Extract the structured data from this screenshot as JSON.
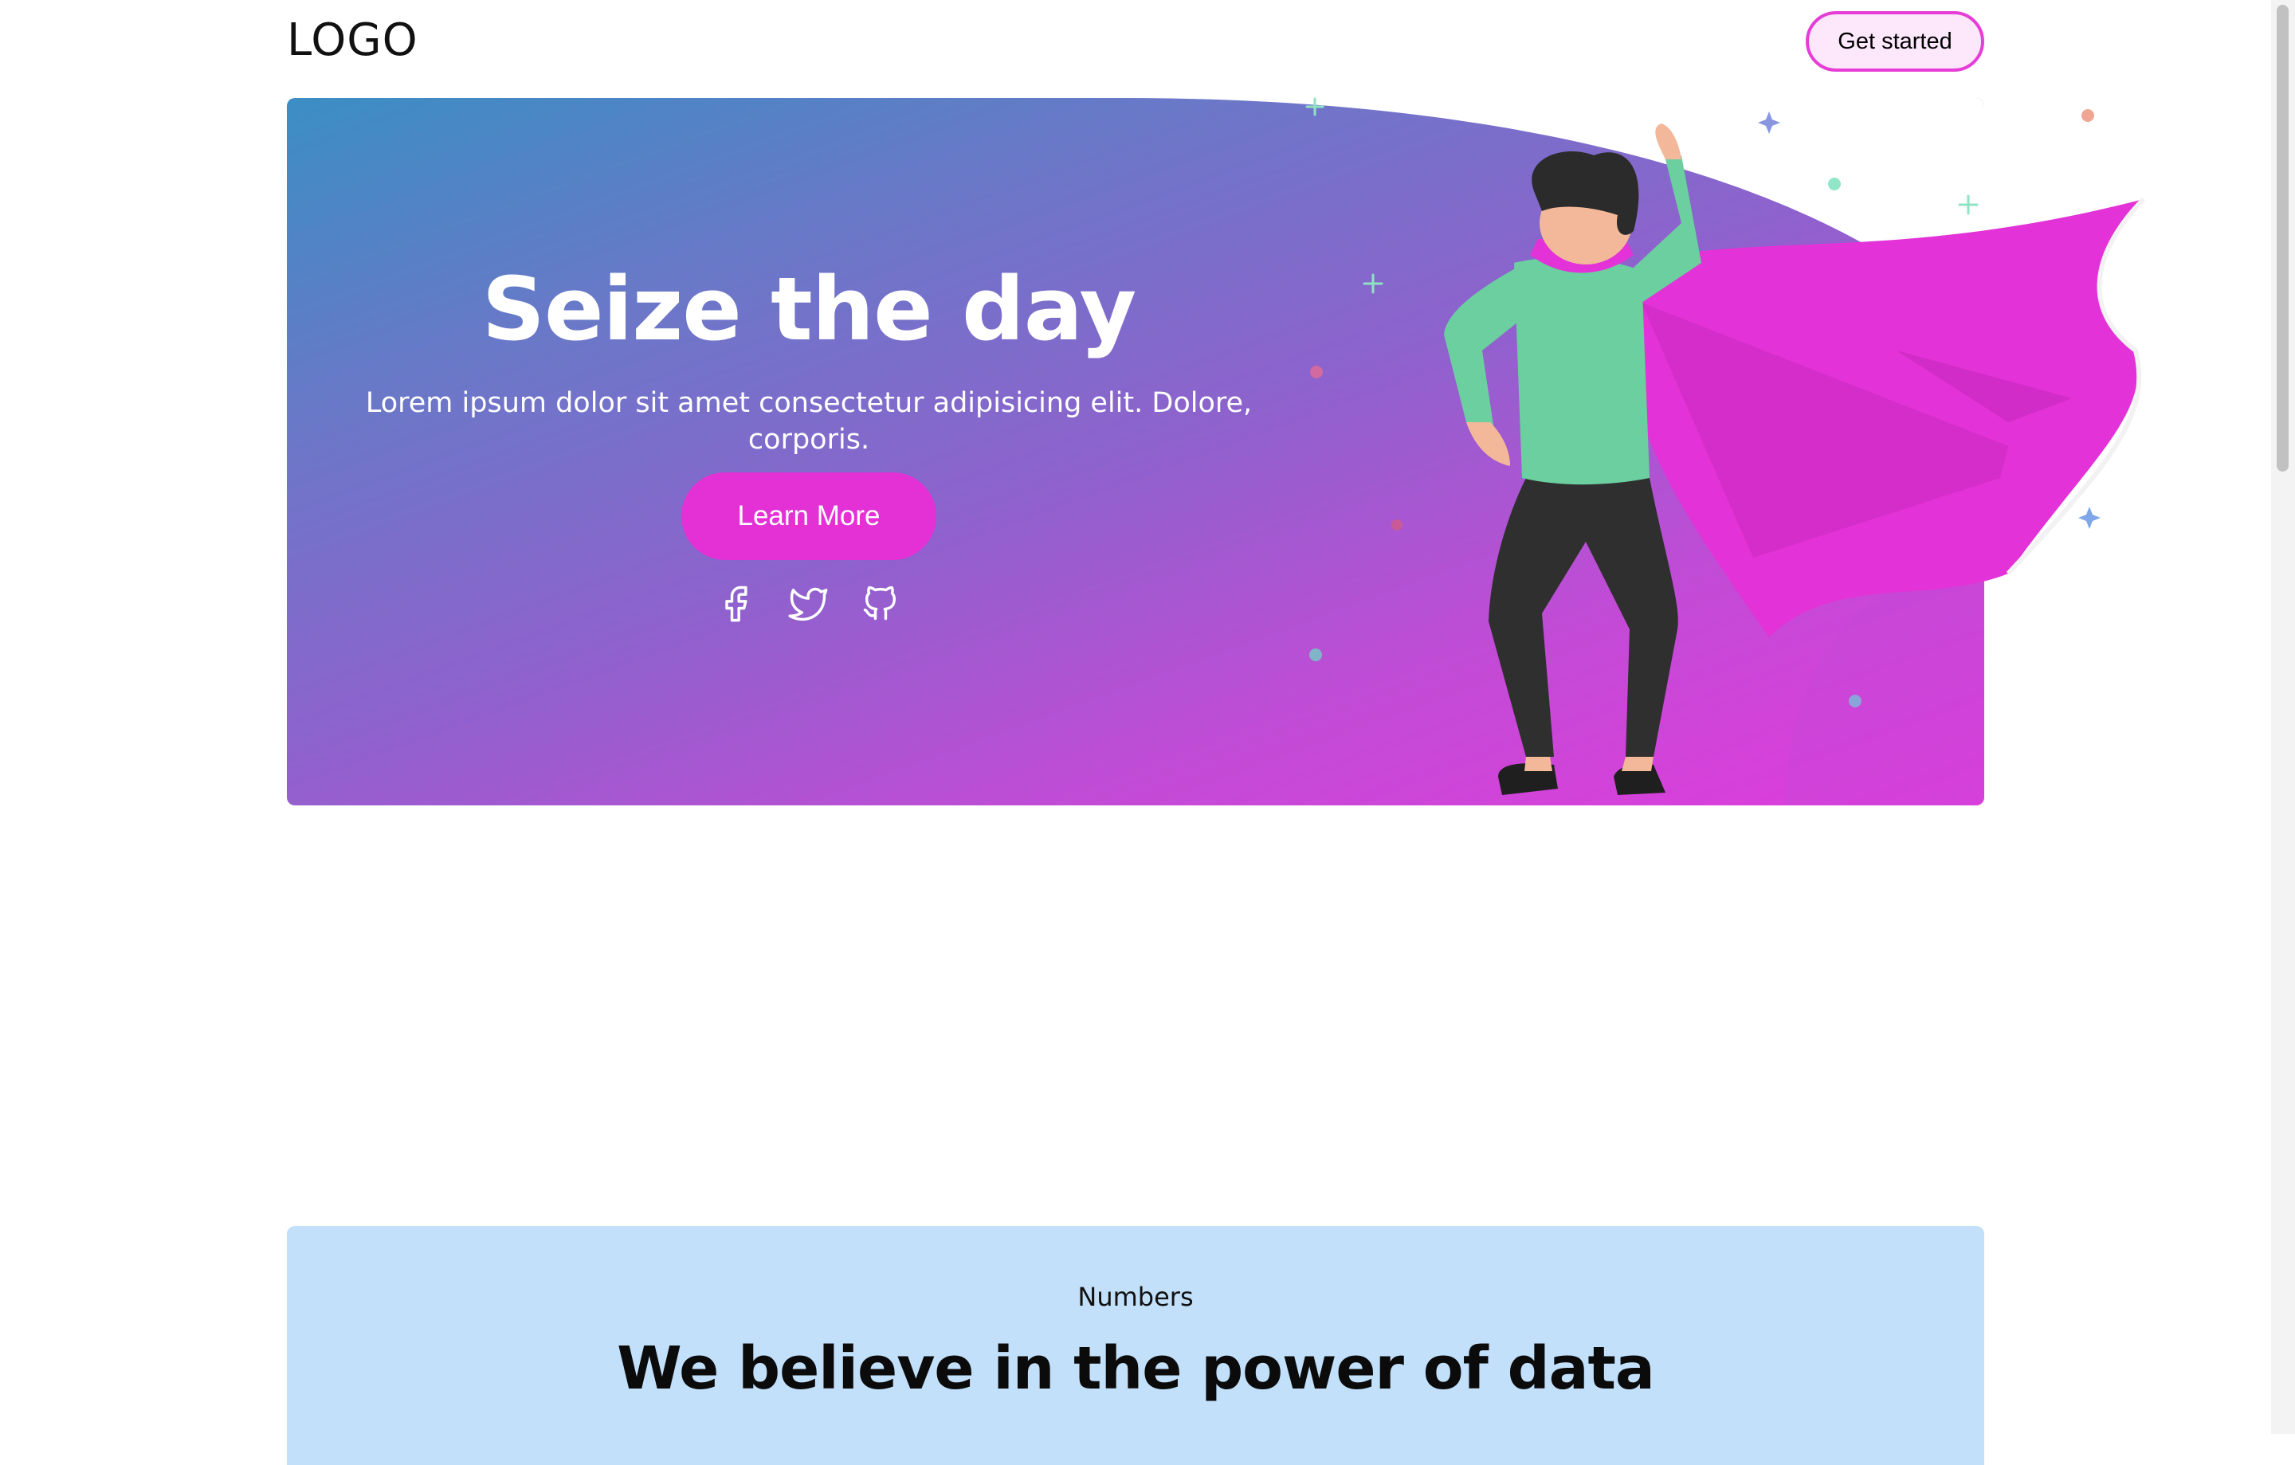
{
  "header": {
    "logo": "LOGO",
    "cta_label": "Get started"
  },
  "hero": {
    "title": "Seize the day",
    "subtitle": "Lorem ipsum dolor sit amet consectetur adipisicing elit. Dolore, corporis.",
    "button_label": "Learn More",
    "socials": [
      "facebook-icon",
      "twitter-icon",
      "github-icon"
    ]
  },
  "numbers": {
    "eyebrow": "Numbers",
    "title": "We believe in the power of data"
  },
  "colors": {
    "accent": "#e331d5",
    "hero_gradient_start": "#3b8ec4",
    "hero_gradient_end": "#e03bdc",
    "numbers_bg": "#c2e0fa"
  }
}
